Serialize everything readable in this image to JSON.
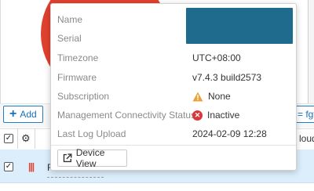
{
  "toolbar": {
    "add_label": "Add",
    "filter_text": "= fgt"
  },
  "table": {
    "header_partial": "loud",
    "row_name_partial": "F"
  },
  "device_card": {
    "rows": [
      {
        "label": "Name",
        "value": ""
      },
      {
        "label": "Serial",
        "value": ""
      },
      {
        "label": "Timezone",
        "value": "UTC+08:00"
      },
      {
        "label": "Firmware",
        "value": "v7.4.3 build2573"
      },
      {
        "label": "Subscription",
        "value": "None",
        "status_icon": "warning-icon"
      },
      {
        "label": "Management Connectivity Status",
        "value": "Inactive",
        "status_icon": "error-icon"
      },
      {
        "label": "Last Log Upload",
        "value": "2024-02-09 12:28"
      }
    ],
    "device_view_label": "Device View"
  },
  "colors": {
    "accent": "#1e7ec8",
    "donut": "#e0412f",
    "redaction": "#1e6b8e",
    "selected_row": "#dceefb",
    "warning": "#e8a33d",
    "error": "#d9363e"
  }
}
